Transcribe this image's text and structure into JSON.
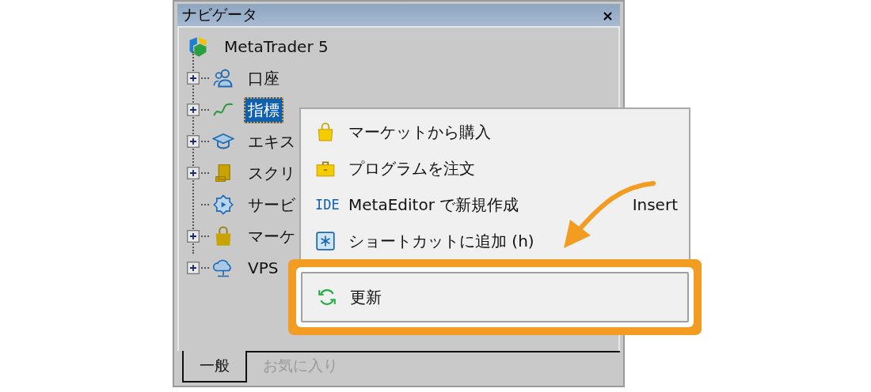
{
  "navigator": {
    "title": "ナビゲータ",
    "close": "×",
    "root": {
      "label": "MetaTrader 5",
      "children": [
        {
          "label": "口座",
          "kind": "people",
          "expandable": true,
          "selected": false
        },
        {
          "label": "指標",
          "kind": "wave",
          "expandable": true,
          "selected": true
        },
        {
          "label": "エキス",
          "kind": "cap",
          "expandable": true,
          "selected": false
        },
        {
          "label": "スクリ",
          "kind": "scroll",
          "expandable": true,
          "selected": false
        },
        {
          "label": "サービ",
          "kind": "gear",
          "expandable": false,
          "selected": false
        },
        {
          "label": "マーケ",
          "kind": "bag",
          "expandable": true,
          "selected": false
        },
        {
          "label": "VPS",
          "kind": "cloud",
          "expandable": true,
          "selected": false
        }
      ]
    },
    "tabs": [
      {
        "label": "一般",
        "selected": true
      },
      {
        "label": "お気に入り",
        "selected": false
      }
    ]
  },
  "context_menu": {
    "items": [
      {
        "kind": "bag",
        "label": "マーケットから購入",
        "highlighted": false
      },
      {
        "kind": "case",
        "label": "プログラムを注文",
        "highlighted": false
      },
      {
        "kind": "ide",
        "icon_text": "IDE",
        "label": "MetaEditor で新規作成",
        "shortcut": "Insert",
        "highlighted": false
      },
      {
        "kind": "star",
        "label": "ショートカットに追加 (h)",
        "highlighted": false
      },
      {
        "kind": "refresh",
        "label": "更新",
        "highlighted": true
      }
    ]
  }
}
